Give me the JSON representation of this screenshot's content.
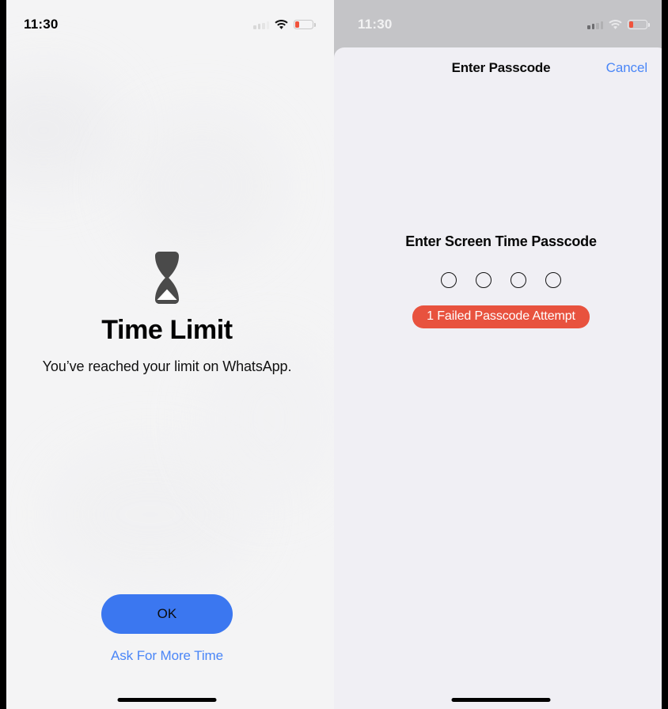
{
  "left_panel": {
    "status_bar": {
      "time": "11:30",
      "cellular_icon": "cellular-signal-icon",
      "wifi_icon": "wifi-icon",
      "battery_icon": "battery-low-icon"
    },
    "icon": "hourglass-icon",
    "title": "Time Limit",
    "subtitle": "You’ve reached your limit on WhatsApp.",
    "ok_label": "OK",
    "more_time_label": "Ask For More Time",
    "ok_color": "#3b77f0",
    "link_color": "#4a86f7",
    "home_indicator": "home-indicator"
  },
  "right_panel": {
    "status_bar": {
      "time": "11:30",
      "cellular_icon": "cellular-signal-icon",
      "wifi_icon": "wifi-icon",
      "battery_icon": "battery-low-icon"
    },
    "sheet": {
      "nav_title": "Enter Passcode",
      "cancel_label": "Cancel",
      "prompt": "Enter Screen Time Passcode",
      "passcode_length": 4,
      "passcode_entered": 0,
      "error_badge": "1 Failed Passcode Attempt",
      "error_color": "#e8523e",
      "cancel_color": "#4a86f7",
      "background": "#f0eff4"
    },
    "home_indicator": "home-indicator"
  }
}
